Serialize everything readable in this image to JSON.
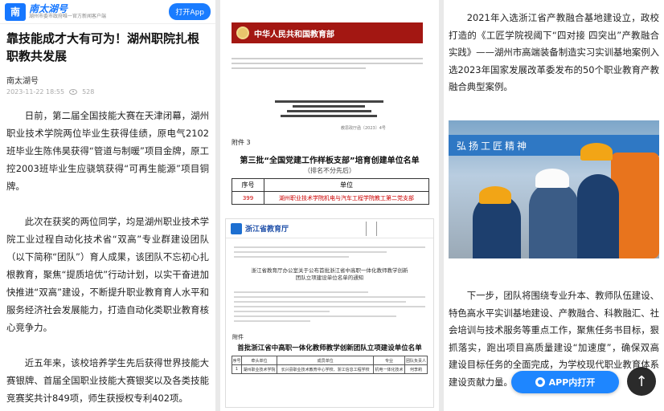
{
  "header": {
    "logo_text": "南",
    "brand_name": "南太湖号",
    "brand_sub": "湖州市委市政府唯一官方新闻客户端",
    "open_app": "打开App"
  },
  "article": {
    "title": "靠技能成才大有可为！湖州职院扎根职教共发展",
    "author": "南太湖号",
    "date": "2023-11-22 18:55",
    "views": "528",
    "paragraphs": [
      "日前，第二届全国技能大赛在天津闭幕，湖州职业技术学院两位毕业生获得佳绩，原电气2102班毕业生陈伟昊获得“管道与制暖”项目金牌，原工控2003班毕业生应骁筑获得“可再生能源”项目铜牌。",
      "此次在获奖的两位同学，均是湖州职业技术学院工业过程自动化技术省“双高”专业群建设团队（以下简称“团队”）育人成果，该团队不忘初心扎根教育，聚焦“提质培优”行动计划，以实干奋进加快推进“双高”建设，不断提升职业教育育人水平和服务经济社会发展能力，打造自动化类职业教育核心竞争力。",
      "近五年来，该校培养学生先后获得世界技能大赛银牌、首届全国职业技能大赛银奖以及各类技能竞赛奖共计849项，师生获授权专利402项。"
    ],
    "right_paragraph_1": "2021年入选浙江省产教融合基地建设立，政校打造的《工匠学院视阈下“四对接 四突出”产教融合实践》——湖州市高端装备制造实习实训基地案例入选2023年国家发展改革委发布的50个职业教育产教融合典型案例。",
    "right_paragraph_2": "下一步，团队将围绕专业升本、教师队伍建设、特色高水平实训基地建设、产教融合、科教融汇、社会培训与技术服务等重点工作，聚焦任务书目标，狠抓落实，跑出项目高质量建设“加速度”，确保双高建设目标任务的全面完成，为学校现代职业教育体系建设贡献力量。"
  },
  "doc1": {
    "banner": "中华人民共和国教育部",
    "notice_num": "教思政厅函〔2023〕4号",
    "attach": "附件 3",
    "attach_title": "第三批“全国党建工作样板支部”培育创建单位名单",
    "attach_sub": "（排名不分先后）",
    "col_no": "序号",
    "col_unit": "单位",
    "row_no": "399",
    "row_unit": "湖州职业技术学院机电与汽车工程学院教工第二党支部"
  },
  "doc2": {
    "org": "浙江省教育厅",
    "title": "浙江省教育厅办公室关于公布首批浙江省中高职一体化教师教学创新团队立项建设单位名单的通知",
    "attach": "附件",
    "list_title": "首批浙江省中高职一体化教师教学创新团队立项建设单位名单",
    "cols": [
      "序号",
      "牵头单位",
      "成员单位",
      "专业",
      "团队负责人"
    ],
    "row": [
      "1",
      "湖州职业技术学院",
      "长兴县职业技术教育中心学校、浙江信息工程学校",
      "机电一体化技术",
      "何李莉"
    ]
  },
  "photo": {
    "banner": "弘扬工匠精神"
  },
  "floating": {
    "app_button": "APP内打开",
    "to_top": "↑"
  }
}
